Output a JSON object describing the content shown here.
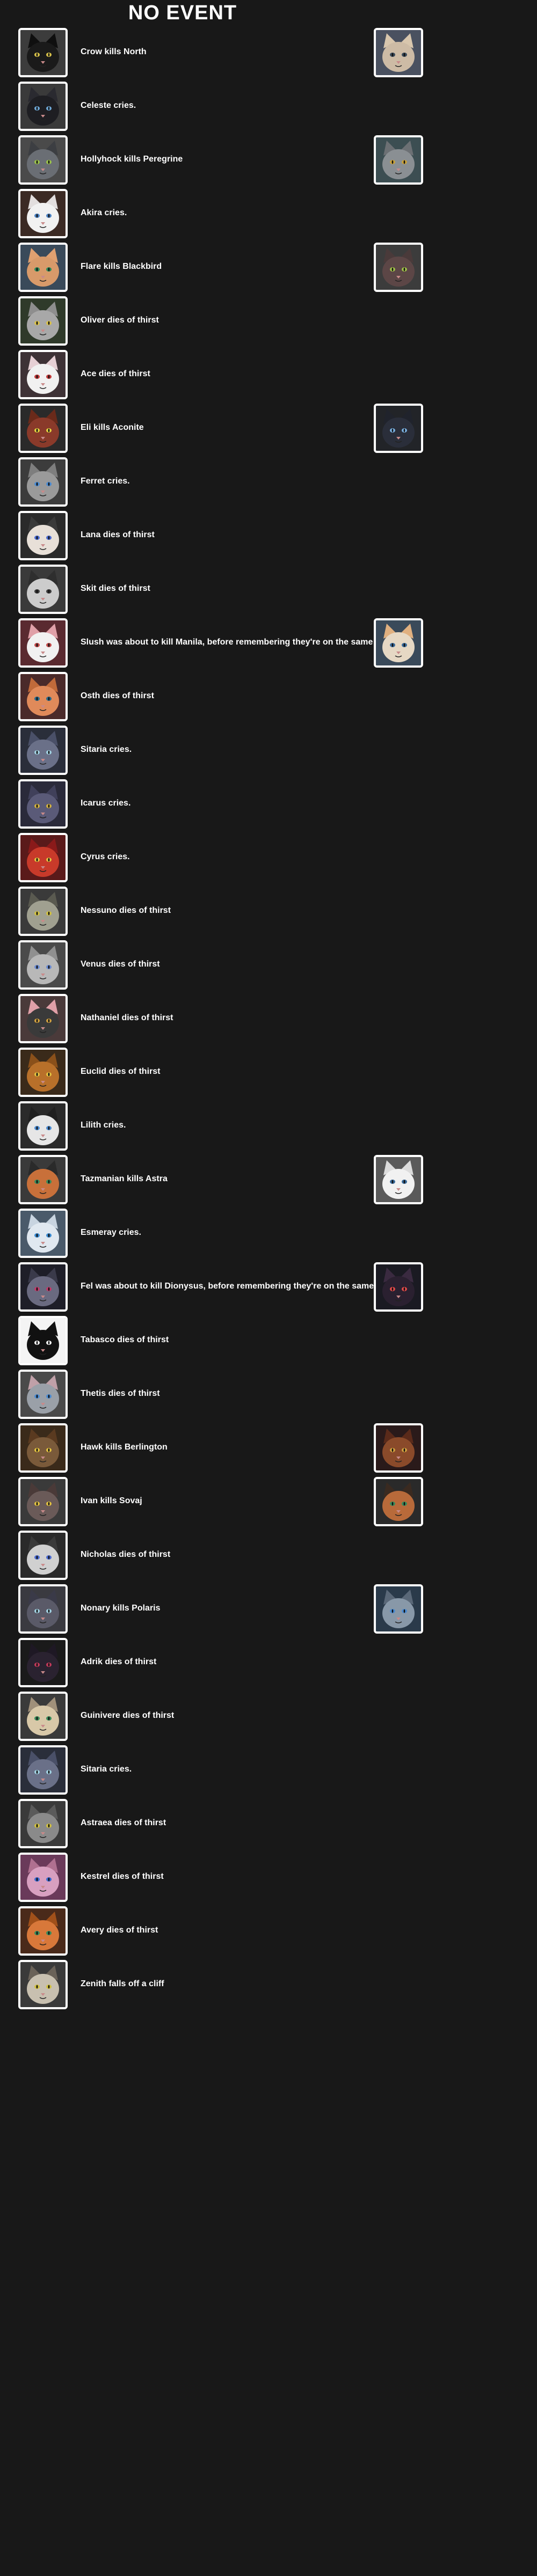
{
  "page": {
    "title": "NO EVENT"
  },
  "colors": {
    "background": "#181818",
    "text": "#ffffff",
    "frame": "#ffffff"
  },
  "events": [
    {
      "text": "Crow kills North",
      "left": {
        "name": "Crow",
        "bg": "#3c3c3c",
        "fur": "#1a1a1a",
        "ear": "#0f0f0f",
        "eye": "#d8c24a"
      },
      "right": {
        "name": "North",
        "bg": "#4a5160",
        "fur": "#cdbba5",
        "ear": "#d8c6ad",
        "eye": "#3a4a5a"
      }
    },
    {
      "text": "Celeste cries.",
      "left": {
        "name": "Celeste",
        "bg": "#3a3a3a",
        "fur": "#1e1e22",
        "ear": "#2a2a30",
        "eye": "#6fa8d6"
      }
    },
    {
      "text": "Hollyhock kills Peregrine",
      "left": {
        "name": "Hollyhock",
        "bg": "#4a4a4a",
        "fur": "#6a6e74",
        "ear": "#3c3e42",
        "eye": "#9ac24a"
      },
      "right": {
        "name": "Peregrine",
        "bg": "#3c4e52",
        "fur": "#8a8f93",
        "ear": "#6c7074",
        "eye": "#c9a23a"
      }
    },
    {
      "text": "Akira cries.",
      "left": {
        "name": "Akira",
        "bg": "#3b2a24",
        "fur": "#f1f1f1",
        "ear": "#e2dede",
        "eye": "#4a80c0"
      }
    },
    {
      "text": "Flare kills Blackbird",
      "left": {
        "name": "Flare",
        "bg": "#3a4a5a",
        "fur": "#d89a6a",
        "ear": "#e0a070",
        "eye": "#2f8a5a"
      },
      "right": {
        "name": "Blackbird",
        "bg": "#3c3c3c",
        "fur": "#5c4646",
        "ear": "#4a3a3a",
        "eye": "#a0c04a"
      }
    },
    {
      "text": "Oliver dies of thirst",
      "left": {
        "name": "Oliver",
        "bg": "#2f3a2a",
        "fur": "#a8a8a8",
        "ear": "#8e8e8e",
        "eye": "#d8c04a"
      }
    },
    {
      "text": "Ace dies of thirst",
      "left": {
        "name": "Ace",
        "bg": "#3e3236",
        "fur": "#f1f1f1",
        "ear": "#e6cfd4",
        "eye": "#c03a3a"
      }
    },
    {
      "text": "Eli kills Aconite",
      "left": {
        "name": "Eli",
        "bg": "#2a2a2a",
        "fur": "#8a3a2a",
        "ear": "#6a2a1a",
        "eye": "#e0d040"
      },
      "right": {
        "name": "Aconite",
        "bg": "#222428",
        "fur": "#2a2e3a",
        "ear": "#20232c",
        "eye": "#7ab0e0"
      }
    },
    {
      "text": "Ferret cries.",
      "left": {
        "name": "Ferret",
        "bg": "#3c3c3c",
        "fur": "#9a9a9a",
        "ear": "#7e7e7e",
        "eye": "#4a8ad0"
      }
    },
    {
      "text": "Lana dies of thirst",
      "left": {
        "name": "Lana",
        "bg": "#2a2a2a",
        "fur": "#e8e0d8",
        "ear": "#3a3a3a",
        "eye": "#4a6ad0"
      }
    },
    {
      "text": "Skit dies of thirst",
      "left": {
        "name": "Skit",
        "bg": "#3a3a3a",
        "fur": "#cccccc",
        "ear": "#2e2e2e",
        "eye": "#3a3a3a"
      }
    },
    {
      "text": "Slush was about to kill Manila, before remembering they're on the same team",
      "left": {
        "name": "Slush",
        "bg": "#5a2a30",
        "fur": "#f1f1f1",
        "ear": "#e0a0a8",
        "eye": "#c04a4a"
      },
      "right": {
        "name": "Manila",
        "bg": "#3a4a5a",
        "fur": "#e6d8c4",
        "ear": "#e0b080",
        "eye": "#3a6a9a"
      }
    },
    {
      "text": "Osth dies of thirst",
      "left": {
        "name": "Osth",
        "bg": "#4a2a2a",
        "fur": "#e08a5a",
        "ear": "#c06a3a",
        "eye": "#2a6a8a"
      }
    },
    {
      "text": "Sitaria cries.",
      "left": {
        "name": "Sitaria",
        "bg": "#2a2e3a",
        "fur": "#6a7088",
        "ear": "#4a5068",
        "eye": "#a0d0e0"
      }
    },
    {
      "text": "Icarus cries.",
      "left": {
        "name": "Icarus",
        "bg": "#2a2a3a",
        "fur": "#5a5a78",
        "ear": "#40405a",
        "eye": "#d0b040"
      }
    },
    {
      "text": "Cyrus cries.",
      "left": {
        "name": "Cyrus",
        "bg": "#5a1a1a",
        "fur": "#c83a2a",
        "ear": "#8a1a1a",
        "eye": "#e0c040"
      }
    },
    {
      "text": "Nessuno dies of thirst",
      "left": {
        "name": "Nessuno",
        "bg": "#3a3a3a",
        "fur": "#a0a090",
        "ear": "#5a5a50",
        "eye": "#d0c040"
      }
    },
    {
      "text": "Venus dies of thirst",
      "left": {
        "name": "Venus",
        "bg": "#4a4a4a",
        "fur": "#b8b8b8",
        "ear": "#909090",
        "eye": "#6a8ad0"
      }
    },
    {
      "text": "Nathaniel dies of thirst",
      "left": {
        "name": "Nathaniel",
        "bg": "#4a3a3a",
        "fur": "#3a3a3a",
        "ear": "#e0a0a8",
        "eye": "#d0a040"
      }
    },
    {
      "text": "Euclid dies of thirst",
      "left": {
        "name": "Euclid",
        "bg": "#3a2a1a",
        "fur": "#b8702a",
        "ear": "#8a501a",
        "eye": "#e0c040"
      }
    },
    {
      "text": "Lilith cries.",
      "left": {
        "name": "Lilith",
        "bg": "#2a2a2a",
        "fur": "#e6e6e6",
        "ear": "#202020",
        "eye": "#4a8ad0"
      }
    },
    {
      "text": "Tazmanian kills Astra",
      "left": {
        "name": "Tazmanian",
        "bg": "#3a3a3a",
        "fur": "#c8703a",
        "ear": "#2a2a2a",
        "eye": "#3a8a5a"
      },
      "right": {
        "name": "Astra",
        "bg": "#5a5a5a",
        "fur": "#f1f1f1",
        "ear": "#dcdcdc",
        "eye": "#3a6a9a"
      }
    },
    {
      "text": "Esmeray cries.",
      "left": {
        "name": "Esmeray",
        "bg": "#4a5a6a",
        "fur": "#e0e8f0",
        "ear": "#c8d4e0",
        "eye": "#3a8ad0"
      }
    },
    {
      "text": "Fel was about to kill Dionysus, before remembering they're on the same team",
      "left": {
        "name": "Fel",
        "bg": "#1e1e28",
        "fur": "#6a6a80",
        "ear": "#3a3a4a",
        "eye": "#c03a6a"
      },
      "right": {
        "name": "Dionysus",
        "bg": "#1a1a22",
        "fur": "#2a2030",
        "ear": "#3a2a40",
        "eye": "#e04a4a"
      }
    },
    {
      "text": "Tabasco dies of thirst",
      "left": {
        "name": "Tabasco",
        "bg": "#f4f4f4",
        "fur": "#111111",
        "ear": "#111111",
        "eye": "#f4f4f4"
      }
    },
    {
      "text": "Thetis dies of thirst",
      "left": {
        "name": "Thetis",
        "bg": "#4a4a4a",
        "fur": "#9aa0a8",
        "ear": "#c0a0a8",
        "eye": "#4a8ad0"
      }
    },
    {
      "text": "Hawk kills Berlington",
      "left": {
        "name": "Hawk",
        "bg": "#3a2a1a",
        "fur": "#7a5a3a",
        "ear": "#5a3a20",
        "eye": "#e0c040"
      },
      "right": {
        "name": "Berlington",
        "bg": "#2a1a1a",
        "fur": "#8a4a2a",
        "ear": "#5a2a1a",
        "eye": "#d0a040"
      }
    },
    {
      "text": "Ivan kills Sovaj",
      "left": {
        "name": "Ivan",
        "bg": "#3a3a3a",
        "fur": "#6a5a58",
        "ear": "#4a3a38",
        "eye": "#e0c040"
      },
      "right": {
        "name": "Sovaj",
        "bg": "#2a2a2a",
        "fur": "#b86a3a",
        "ear": "#3a2a20",
        "eye": "#3a8a5a"
      }
    },
    {
      "text": "Nicholas dies of thirst",
      "left": {
        "name": "Nicholas",
        "bg": "#2a2a2a",
        "fur": "#d0d0d0",
        "ear": "#3a3a3a",
        "eye": "#4a6ad0"
      }
    },
    {
      "text": "Nonary kills Polaris",
      "left": {
        "name": "Nonary",
        "bg": "#3a3a40",
        "fur": "#5a5a68",
        "ear": "#3a3a48",
        "eye": "#a0d0e0"
      },
      "right": {
        "name": "Polaris",
        "bg": "#2a3a4a",
        "fur": "#8898a8",
        "ear": "#5a6878",
        "eye": "#4a8ad0"
      }
    },
    {
      "text": "Adrik dies of thirst",
      "left": {
        "name": "Adrik",
        "bg": "#1a1a1a",
        "fur": "#2a2230",
        "ear": "#1e1824",
        "eye": "#c03a5a"
      }
    },
    {
      "text": "Guinivere dies of thirst",
      "left": {
        "name": "Guinivere",
        "bg": "#3a3a3a",
        "fur": "#d8c8a8",
        "ear": "#a0907a",
        "eye": "#3a8a5a"
      }
    },
    {
      "text": "Sitaria cries.",
      "left": {
        "name": "Sitaria",
        "bg": "#2a2e3a",
        "fur": "#6a7088",
        "ear": "#4a5068",
        "eye": "#a0d0e0"
      }
    },
    {
      "text": "Astraea dies of thirst",
      "left": {
        "name": "Astraea",
        "bg": "#3a3a3a",
        "fur": "#8a8a8a",
        "ear": "#5a5a5a",
        "eye": "#d0c040"
      }
    },
    {
      "text": "Kestrel dies of thirst",
      "left": {
        "name": "Kestrel",
        "bg": "#6a3a5a",
        "fur": "#d8a0c0",
        "ear": "#b07090",
        "eye": "#3a6ad0"
      }
    },
    {
      "text": "Avery dies of thirst",
      "left": {
        "name": "Avery",
        "bg": "#4a2a1a",
        "fur": "#d8783a",
        "ear": "#a0501a",
        "eye": "#3a8a5a"
      }
    },
    {
      "text": "Zenith falls off a cliff",
      "left": {
        "name": "Zenith",
        "bg": "#3a3a3a",
        "fur": "#c8c0b0",
        "ear": "#6a6258",
        "eye": "#d0c040"
      }
    }
  ]
}
